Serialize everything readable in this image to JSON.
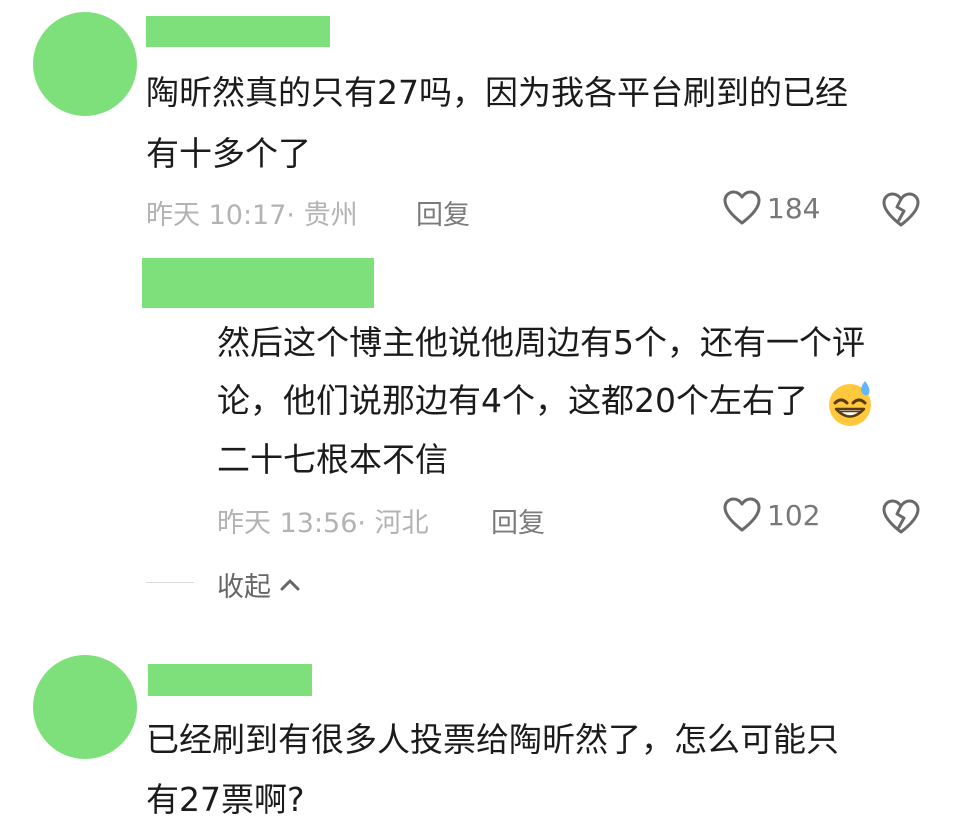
{
  "comments": [
    {
      "lines": [
        "陶昕然真的只有27吗，因为我各平台刷到的已经",
        "有十多个了"
      ],
      "time": "昨天 10:17",
      "location": "· 贵州",
      "reply_label": "回复",
      "likes": "184",
      "replies": [
        {
          "lines": [
            "然后这个博主他说他周边有5个，还有一个评",
            "论，他们说那边有4个，这都20个左右了",
            "二十七根本不信"
          ],
          "time": "昨天 13:56",
          "location": "· 河北",
          "reply_label": "回复",
          "likes": "102"
        }
      ],
      "collapse_label": "收起"
    },
    {
      "lines": [
        "已经刷到有很多人投票给陶昕然了，怎么可能只",
        "有27票啊?"
      ]
    }
  ],
  "colors": {
    "avatar": "#7EE07B",
    "name_placeholder": "#7EE07B",
    "meta": "#b3b3b3",
    "reply": "#7b7b7b"
  },
  "icons": {
    "like": "heart-outline-icon",
    "dislike": "broken-heart-icon",
    "emoji": "sweat-grin-emoji",
    "collapse": "chevron-up-icon"
  }
}
